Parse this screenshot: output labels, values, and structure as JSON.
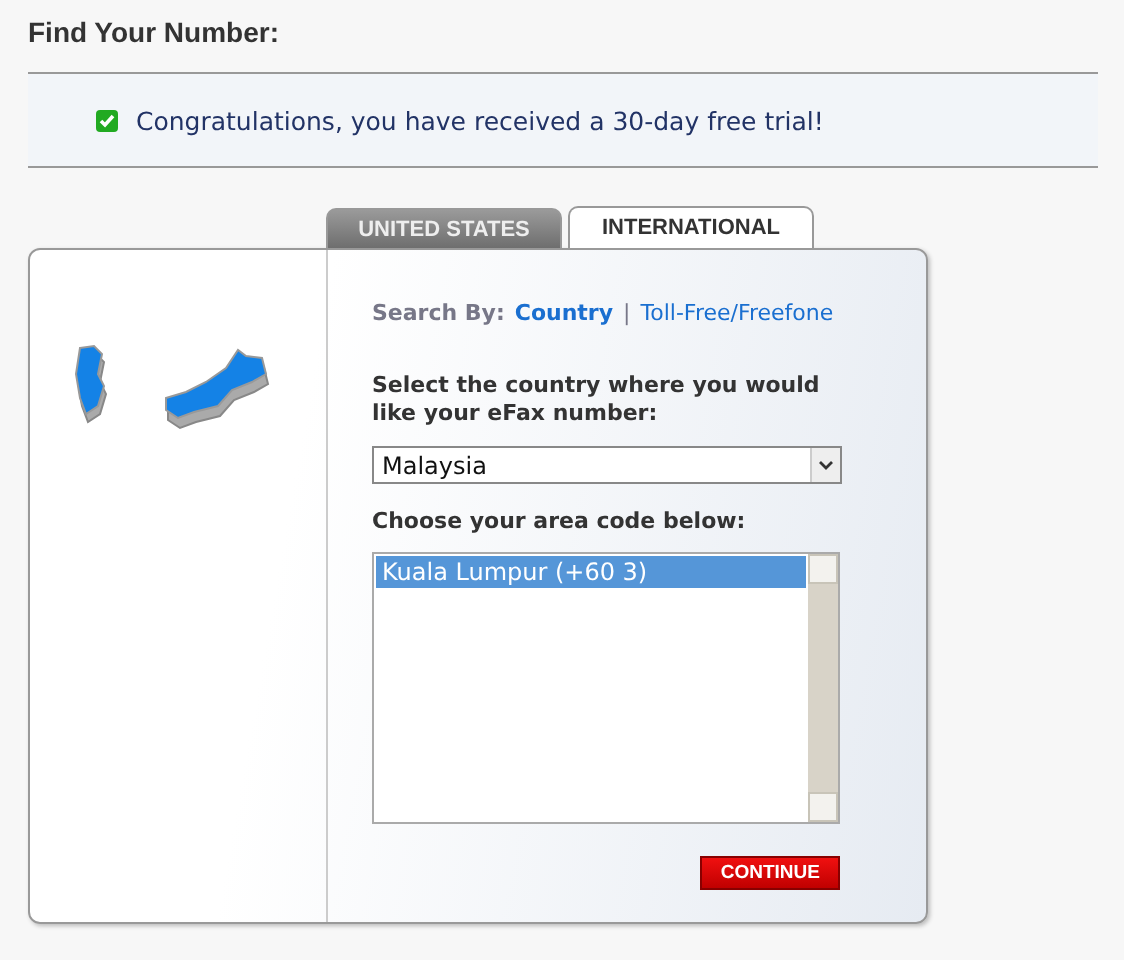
{
  "heading": "Find Your Number:",
  "banner": {
    "checked": true,
    "message": "Congratulations, you have received a 30-day free trial!"
  },
  "tabs": [
    {
      "label": "UNITED STATES",
      "selected": false
    },
    {
      "label": "INTERNATIONAL",
      "selected": true
    }
  ],
  "search_by": {
    "label": "Search By:",
    "options": [
      {
        "label": "Country",
        "selected": true
      },
      {
        "label": "Toll-Free/Freefone",
        "selected": false
      }
    ],
    "separator": "|"
  },
  "country_label": "Select the country where you would like your eFax number:",
  "country_select": {
    "value": "Malaysia"
  },
  "area_label": "Choose your area code below:",
  "area_codes": [
    {
      "label": "Kuala Lumpur (+60 3)",
      "selected": true
    }
  ],
  "continue_button": "CONTINUE"
}
